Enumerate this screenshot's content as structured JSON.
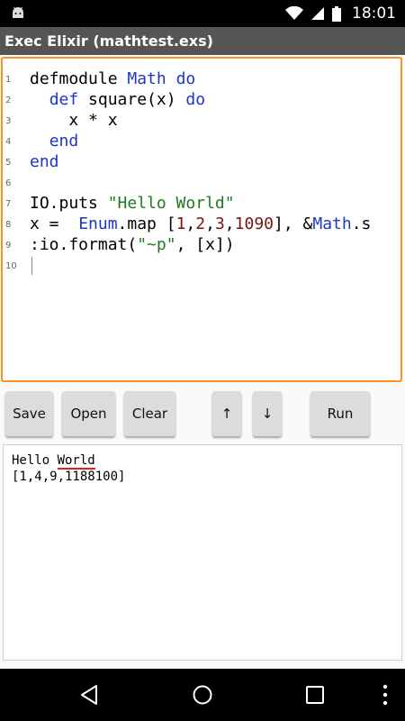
{
  "status_bar": {
    "time": "18:01"
  },
  "app": {
    "title": "Exec Elixir (mathtest.exs)"
  },
  "editor": {
    "lines": [
      {
        "n": "1"
      },
      {
        "n": "2"
      },
      {
        "n": "3"
      },
      {
        "n": "4"
      },
      {
        "n": "5"
      },
      {
        "n": "6"
      },
      {
        "n": "7"
      },
      {
        "n": "8"
      },
      {
        "n": "9"
      },
      {
        "n": "10"
      }
    ],
    "code": [
      [
        "defmodule ",
        "Math",
        " ",
        "do"
      ],
      [
        "  ",
        "def",
        " square(x) ",
        "do"
      ],
      [
        "    x * x"
      ],
      [
        "  ",
        "end"
      ],
      [
        "end"
      ],
      [
        ""
      ],
      [
        "IO.puts ",
        "\"Hello World\""
      ],
      [
        "x =  ",
        "Enum",
        ".map [",
        "1",
        ",",
        "2",
        ",",
        "3",
        ",",
        "1090",
        "], &",
        "Math",
        ".s"
      ],
      [
        ":io.format(",
        "\"~p\"",
        ", [x])"
      ],
      [
        ""
      ]
    ]
  },
  "toolbar": {
    "save": "Save",
    "open": "Open",
    "clear": "Clear",
    "up": "↑",
    "down": "↓",
    "run": "Run"
  },
  "output": {
    "line1_a": "Hello ",
    "line1_b": "World",
    "line2": "[1,4,9,1188100]"
  },
  "colors": {
    "accent": "#f7931e",
    "keyword": "#1f35c4",
    "string": "#1f7a1f",
    "number": "#7a1414"
  },
  "icons": [
    "android-icon",
    "wifi-icon",
    "signal-icon",
    "battery-icon",
    "back-icon",
    "home-icon",
    "recents-icon",
    "overflow-menu-icon"
  ]
}
